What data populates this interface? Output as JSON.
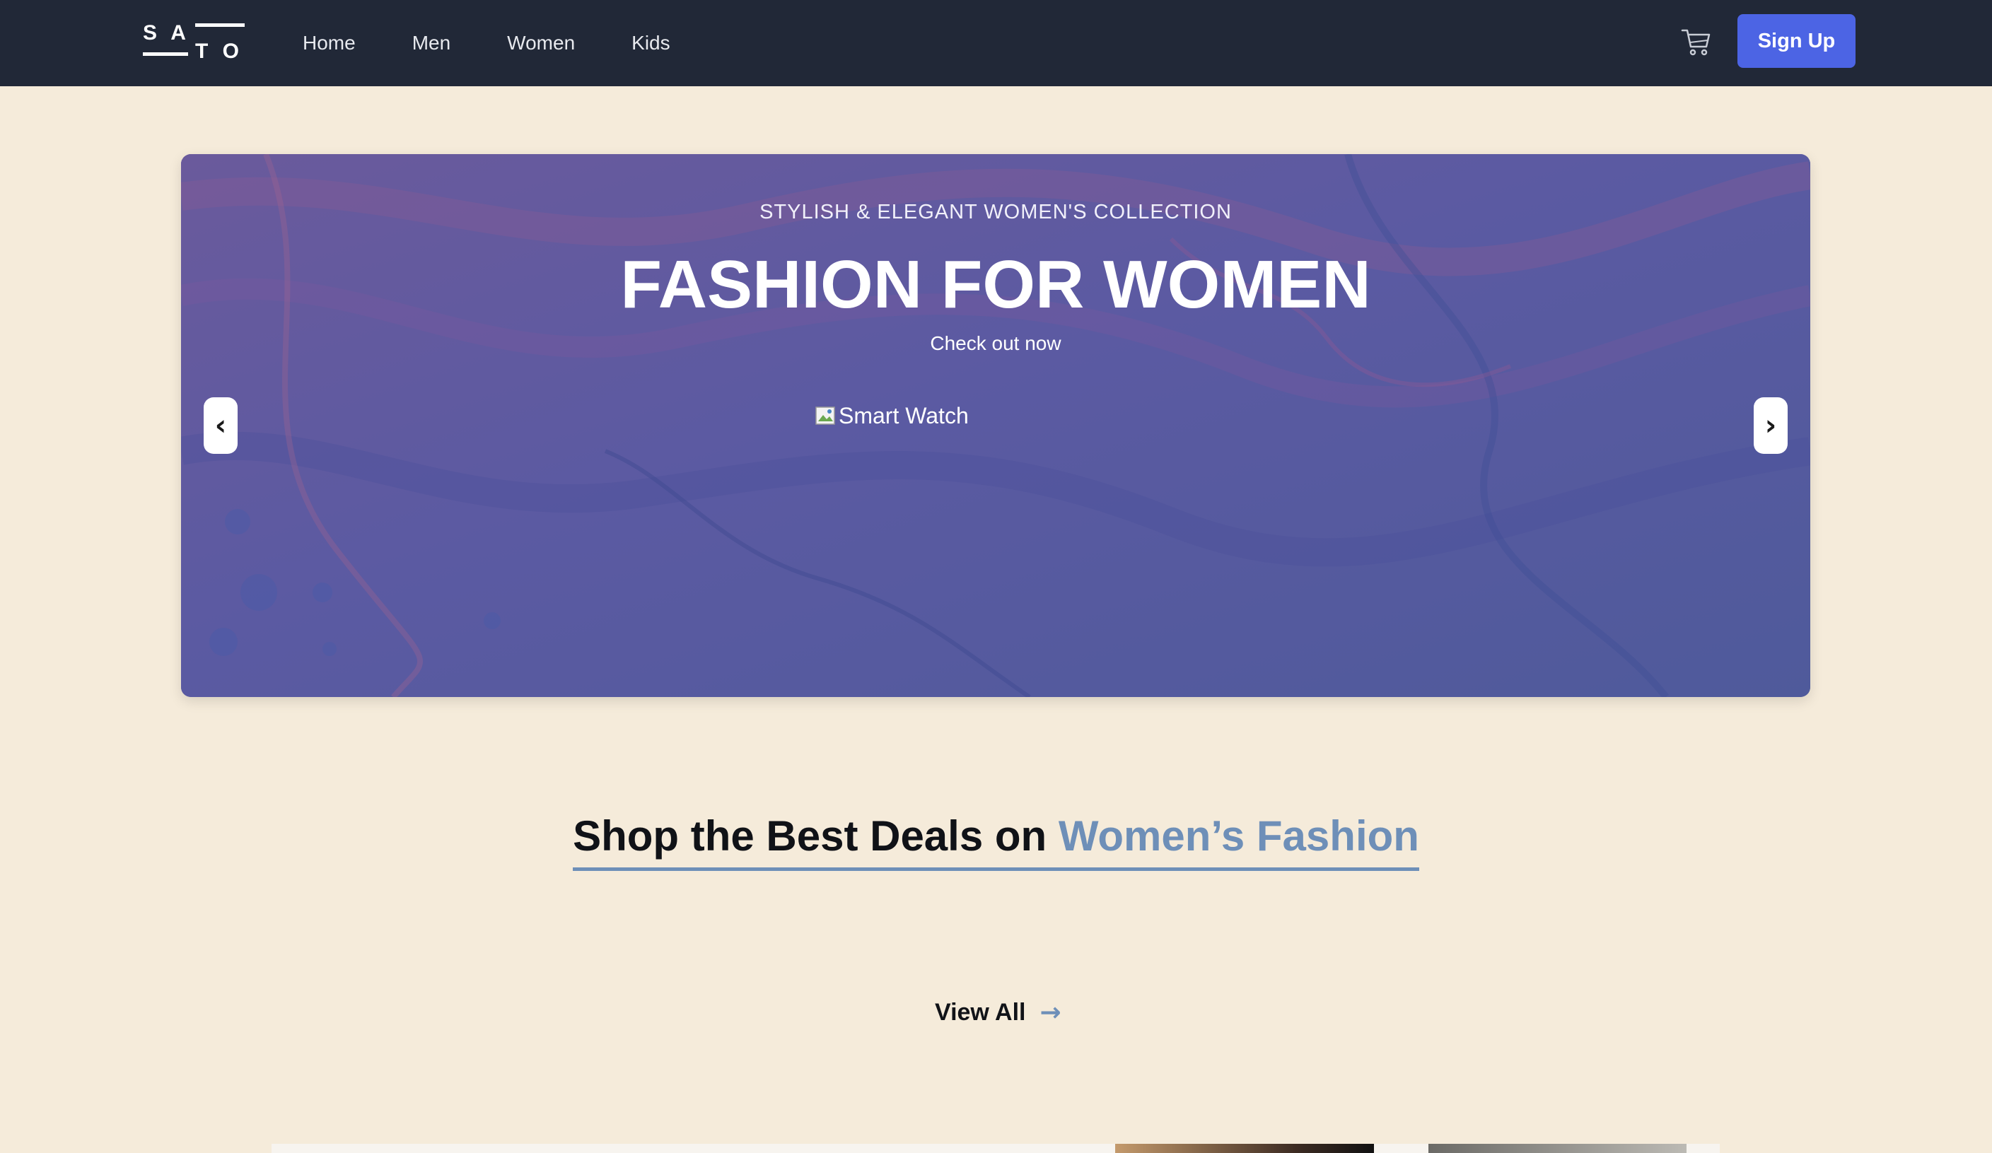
{
  "brand": {
    "logo_text": "SATO"
  },
  "nav": {
    "links": [
      "Home",
      "Men",
      "Women",
      "Kids"
    ],
    "cart_icon": "cart-icon",
    "signup_label": "Sign Up"
  },
  "hero": {
    "subtitle": "STYLISH & ELEGANT WOMEN'S COLLECTION",
    "title": "FASHION FOR WOMEN",
    "cta": "Check out now",
    "image_alt": "Smart Watch",
    "prev_label": "‹",
    "next_label": "›"
  },
  "section": {
    "heading_main": "Shop the Best Deals on ",
    "heading_accent": "Women’s Fashion",
    "view_all": "View All",
    "view_all_arrow": "→"
  },
  "colors": {
    "navbar": "#212837",
    "page_background": "#f5ebda",
    "accent": "#6e8fb8",
    "signup_button": "#4c64e4",
    "hero_overlay": "#5a5a9e"
  }
}
